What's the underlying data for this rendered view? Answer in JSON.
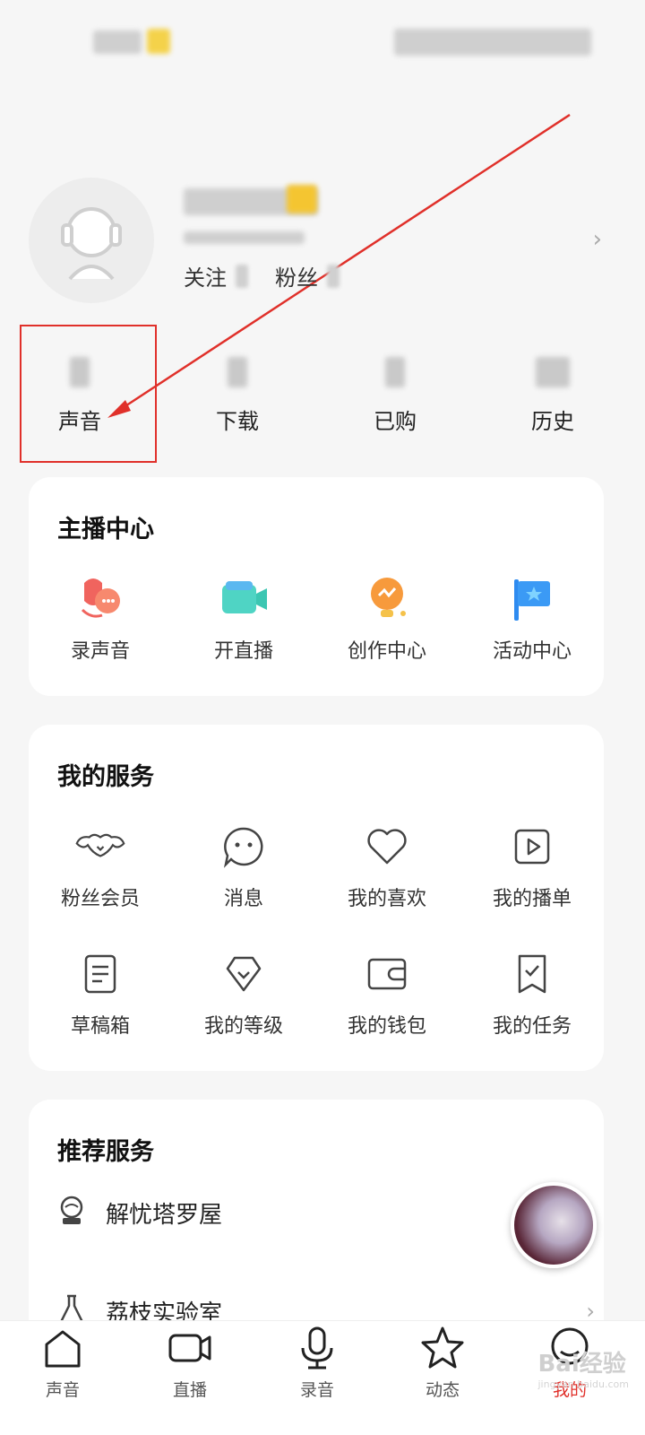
{
  "profile": {
    "follow_label": "关注",
    "fans_label": "粉丝"
  },
  "stats": [
    {
      "label": "声音"
    },
    {
      "label": "下载"
    },
    {
      "label": "已购"
    },
    {
      "label": "历史"
    }
  ],
  "host_center": {
    "title": "主播中心",
    "items": [
      {
        "label": "录声音",
        "icon": "record-voice-icon"
      },
      {
        "label": "开直播",
        "icon": "live-camera-icon"
      },
      {
        "label": "创作中心",
        "icon": "lightbulb-icon"
      },
      {
        "label": "活动中心",
        "icon": "flag-icon"
      }
    ]
  },
  "my_services": {
    "title": "我的服务",
    "items": [
      {
        "label": "粉丝会员",
        "icon": "wings-heart-icon"
      },
      {
        "label": "消息",
        "icon": "chat-bubble-icon"
      },
      {
        "label": "我的喜欢",
        "icon": "heart-icon"
      },
      {
        "label": "我的播单",
        "icon": "play-list-icon"
      },
      {
        "label": "草稿箱",
        "icon": "draft-icon"
      },
      {
        "label": "我的等级",
        "icon": "level-gem-icon"
      },
      {
        "label": "我的钱包",
        "icon": "wallet-icon"
      },
      {
        "label": "我的任务",
        "icon": "task-check-icon"
      }
    ]
  },
  "recommended": {
    "title": "推荐服务",
    "items": [
      {
        "label": "解忧塔罗屋",
        "icon": "crystal-ball-icon"
      },
      {
        "label": "荔枝实验室",
        "icon": "flask-icon"
      }
    ]
  },
  "tabbar": [
    {
      "label": "声音",
      "icon": "home-icon"
    },
    {
      "label": "直播",
      "icon": "video-camera-icon"
    },
    {
      "label": "录音",
      "icon": "microphone-icon"
    },
    {
      "label": "动态",
      "icon": "star-icon"
    },
    {
      "label": "我的",
      "icon": "user-icon",
      "active": true
    }
  ],
  "watermark": {
    "text": "Bai经验",
    "sub": "jingyan.baidu.com"
  },
  "colors": {
    "accent": "#e0302a",
    "background": "#f6f6f6",
    "card": "#ffffff"
  }
}
